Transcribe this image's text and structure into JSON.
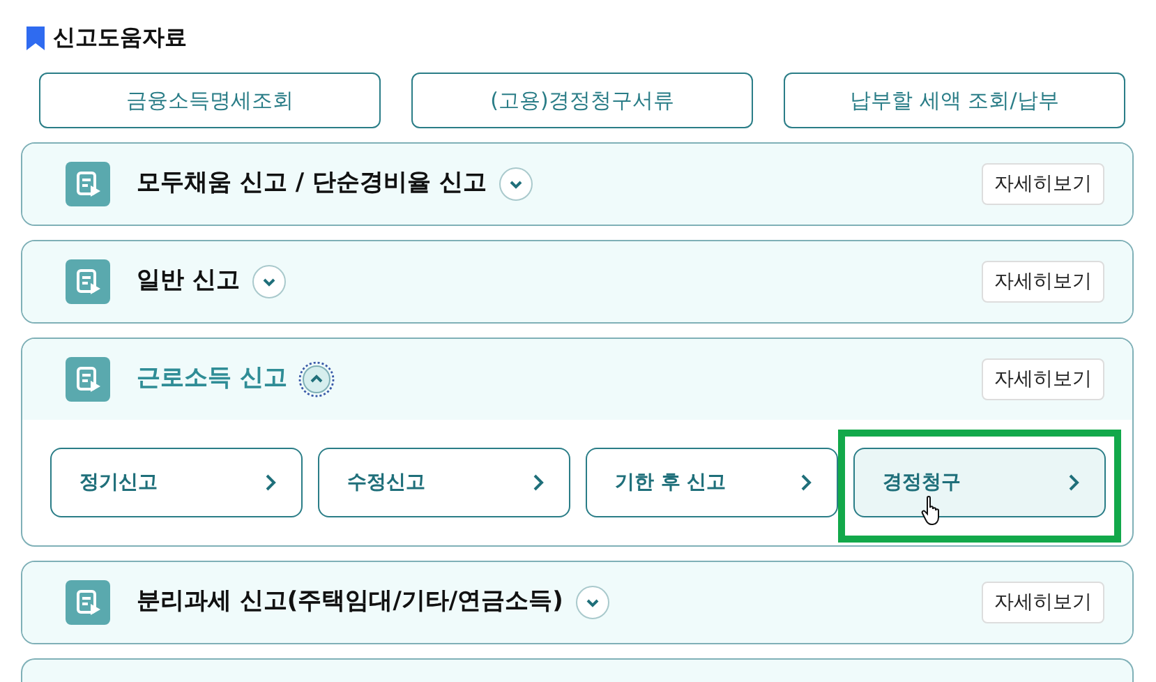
{
  "section_title": "신고도움자료",
  "quick_links": [
    "금융소득명세조회",
    "(고용)경정청구서류",
    "납부할 세액 조회/납부"
  ],
  "panels": [
    {
      "title": "모두채움 신고 / 단순경비율 신고",
      "expanded": false,
      "detail_button": "자세히보기"
    },
    {
      "title": "일반 신고",
      "expanded": false,
      "detail_button": "자세히보기"
    },
    {
      "title": "근로소득 신고",
      "expanded": true,
      "detail_button": "자세히보기",
      "sub_items": [
        {
          "label": "정기신고",
          "selected": false
        },
        {
          "label": "수정신고",
          "selected": false
        },
        {
          "label": "기한 후 신고",
          "selected": false
        },
        {
          "label": "경정청구",
          "selected": true
        }
      ]
    },
    {
      "title": "분리과세 신고(주택임대/기타/연금소득)",
      "expanded": false,
      "detail_button": "자세히보기"
    }
  ]
}
